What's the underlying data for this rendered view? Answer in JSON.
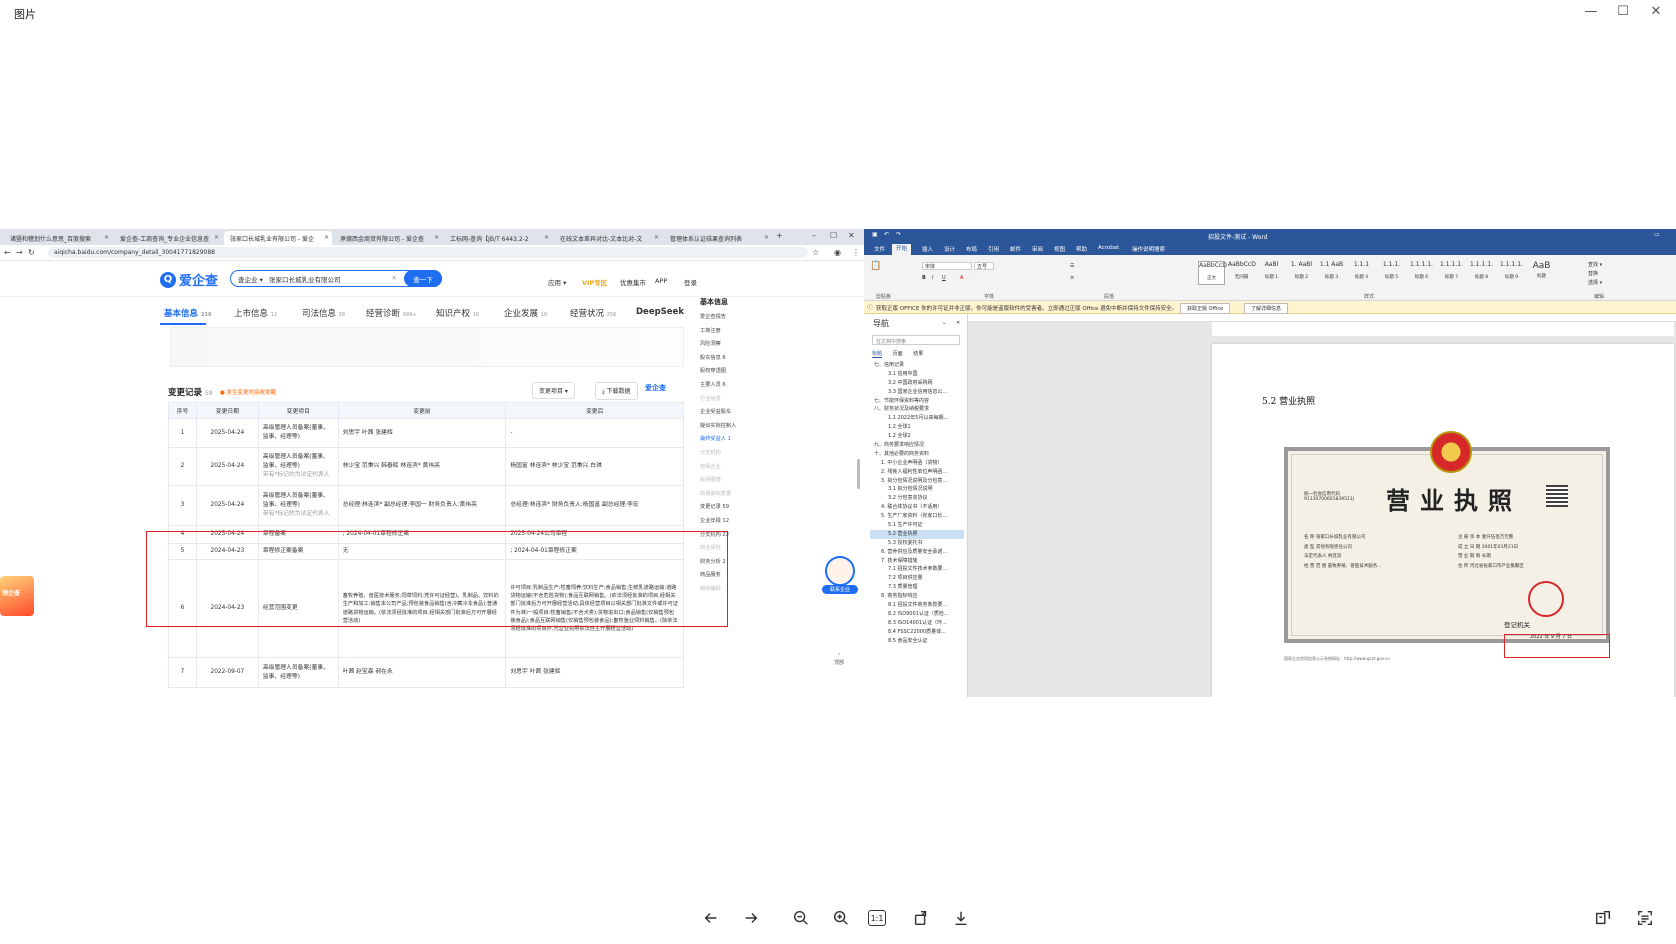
{
  "viewer": {
    "title": "图片",
    "controls": {
      "minimize": "—",
      "maximize": "☐",
      "close": "✕"
    },
    "toolbar_icons": [
      "arrow-left-icon",
      "arrow-right-icon",
      "zoom-out-icon",
      "zoom-in-icon",
      "actual-size-icon",
      "rotate-icon",
      "download-icon",
      "translate-icon",
      "ocr-icon"
    ],
    "actual_size_label": "1:1"
  },
  "browser": {
    "tabs": [
      "诸暨和稽划什么意思_百度搜索",
      "爱企查-工商查询_专业企业信息查",
      "张家口长城乳业有限公司 - 爱企",
      "承德西金周贸有限公司 - 爱企查",
      "工标网-查询【JB/T 6443.2-2",
      "在线文本差异对比-文本比对-文",
      "管理体系认证结果查询列表"
    ],
    "url": "aiqicha.baidu.com/company_detail_30041771829088",
    "site": {
      "logo": "爱企查",
      "search_scope": "查企业 ▾",
      "search_value": "张家口长城乳业有限公司",
      "search_button": "查一下",
      "links": [
        "应用 ▾",
        "VIP专区",
        "优惠集市",
        "APP",
        "登录"
      ]
    },
    "company_tabs": [
      {
        "label": "基本信息",
        "count": "216"
      },
      {
        "label": "上市信息",
        "count": "12"
      },
      {
        "label": "司法信息",
        "count": "58"
      },
      {
        "label": "经营诊断",
        "count": "999+"
      },
      {
        "label": "知识产权",
        "count": "16"
      },
      {
        "label": "企业发展",
        "count": "10"
      },
      {
        "label": "经营状况",
        "count": "256"
      },
      {
        "label": "DeepSeek",
        "count": ""
      }
    ],
    "change_record": {
      "title": "变更记录",
      "count": "59",
      "note": "● 发生变更时接收提醒",
      "filter_label": "变更项目 ▾",
      "download_label": "⤓ 下载数据",
      "badge": "爱企查",
      "headers": [
        "序号",
        "变更日期",
        "变更项目",
        "变更前",
        "变更后"
      ],
      "rows": [
        {
          "no": "1",
          "date": "2025-04-24",
          "item": "高级管理人员备案(董事、监事、经理等)",
          "before": "刘思宇 叶茜 张建辉",
          "after": "-"
        },
        {
          "no": "2",
          "date": "2025-04-24",
          "item": "高级管理人员备案(董事、监事、经理等)",
          "item_note": "带有*标记的为法定代表人",
          "before": "林少宝 范秉兴 韩春辉 林连滨* 黄伟亮",
          "after": "杨国富 林连滨* 林少宝 范秉兴 白琪"
        },
        {
          "no": "3",
          "date": "2025-04-24",
          "item": "高级管理人员备案(董事、监事、经理等)",
          "item_note": "带有*标记的为法定代表人",
          "before": "总经理:林连滨* 副总经理:李国一 财务负责人:黄伟亮",
          "after": "总经理:林连滨* 财务负责人:杨国富 副总经理:李宏"
        },
        {
          "no": "4",
          "date": "2025-04-24",
          "item": "章程备案",
          "before": "; 2024-04-01章程修正案",
          "after": "2025-04-24公司章程"
        },
        {
          "no": "5",
          "date": "2024-04-23",
          "item": "章程修正案备案",
          "before": "无",
          "after": "; 2024-04-01章程修正案"
        },
        {
          "no": "6",
          "date": "2024-04-23",
          "item": "经营范围变更",
          "before": "畜牧养殖、兽医技术服务;饲草饲料;凭许可证经营)。乳制品、饮料的生产和加工;销售本公司产品;预包装食品销售(含冷藏冷冻食品);普通道路货物运输。(依法须经批准的项目,经相关部门批准后方可开展经营活动)",
          "after": "许可项目:乳制品生产;牲畜饲养;饮料生产;食品销售;生鲜乳道路运输;道路货物运输(不含危险货物);食品互联网销售。(依法须经批准的项目,经相关部门批准后方可开展经营活动,具体经营项目以相关部门批准文件或许可证件为准)一般项目:牲畜销售(不含犬类);货物进出口;食品销售(仅销售预包装食品);食品互联网销售(仅销售预包装食品);畜牧渔业饲料销售。(除依法须经批准的项目外,凭营业执照依法自主开展经营活动)"
        },
        {
          "no": "7",
          "date": "2022-09-07",
          "item": "高级管理人员备案(董事、监事、经理等)",
          "before": "叶茜 赵宝森 郝在永",
          "after": "刘思宇 叶茜 张建辉"
        }
      ]
    },
    "side_nav": {
      "title": "基本信息",
      "items": [
        "爱企查报告",
        "工商注册",
        "风险洞察",
        "股东信息 6",
        "股权穿透图",
        "主要人员 6",
        "行业信息",
        "企业受益股东",
        "疑似实际控制人",
        "最终受益人 1",
        "分支机构",
        "控股企业",
        "投资图谱",
        "简易股权变更",
        "变更记录 59",
        "企业年报 12",
        "分支机构 22",
        "商业保险",
        "财务分析 2",
        "商品服务",
        "邮政编码"
      ]
    },
    "contact_label": "联系企业",
    "promo_text": "领企查",
    "back_top": "顶部"
  },
  "word": {
    "title": "招投文件-测试 - Word",
    "menu": [
      "文件",
      "开始",
      "插入",
      "设计",
      "布局",
      "引用",
      "邮件",
      "审阅",
      "视图",
      "帮助",
      "Acrobat",
      "操作说明搜索"
    ],
    "ribbon_groups": [
      "剪贴板",
      "字体",
      "段落",
      "样式",
      "编辑"
    ],
    "font_name": "宋体",
    "font_size": "五号",
    "styles": [
      {
        "preview": "AaBbCcD",
        "label": "正文"
      },
      {
        "preview": "AaBbCcD",
        "label": "无间隔"
      },
      {
        "preview": "AaBl",
        "label": "标题 1"
      },
      {
        "preview": "1. AaBl",
        "label": "标题 2"
      },
      {
        "preview": "1.1 AaB",
        "label": "标题 3"
      },
      {
        "preview": "1.1.1",
        "label": "标题 4"
      },
      {
        "preview": "1.1.1.",
        "label": "标题 5"
      },
      {
        "preview": "1.1.1.1.",
        "label": "标题 6"
      },
      {
        "preview": "1.1.1.1.",
        "label": "标题 7"
      },
      {
        "preview": "1.1.1.1.",
        "label": "标题 8"
      },
      {
        "preview": "1.1.1.1.",
        "label": "标题 9"
      },
      {
        "preview": "AaB",
        "label": "标题"
      }
    ],
    "edit_items": [
      "查找 ▾",
      "替换",
      "选择 ▾"
    ],
    "info_bar": "获取正版 OFFICE  你的许可证并非正版，你可能是盗版软件的受害者。立即通过正版 Office 避免中断并保持文件保持安全。",
    "info_buttons": [
      "获取正版 Office",
      "了解详细信息"
    ],
    "nav_pane": {
      "title": "导航",
      "search_placeholder": "在文档中搜索",
      "tabs": [
        "标题",
        "页面",
        "结果"
      ],
      "tree": [
        "七、信用记录",
        "3.1 信用中国",
        "3.2 中国政府采购网",
        "3.3 国家企业信用信息公...",
        "七、节能环保资料等内容",
        "八、财务状况及纳税要求",
        "1.1 2022年5月以来每期...",
        "1.2 全球1",
        "1.2 全球2",
        "九、商务要求响应情况",
        "十、其他必要的商务资料",
        "1. 中小企业声明函（货物）",
        "2. 残疾人福利性单位声明函...",
        "3. 拟分包情况说明及分包意...",
        "3.1 拟分包情况说明",
        "3.2 分包意向协议",
        "4. 联合体协议书（不适用）",
        "5. 生产厂家资料（张家口长...",
        "5.1 生产许可证",
        "5.2 营业执照",
        "5.3 授权委托书",
        "6. 营养供应及质量安全承诺...",
        "7. 技术保障措施",
        "7.1 招投文件技术参数要...",
        "7.2 项目供应量",
        "7.3 质量管理",
        "8. 商务指标响应",
        "8.1 招投文件商务条款要...",
        "8.2 ISO9001认证（质检...",
        "8.3 ISO14001认证（环...",
        "8.4 FSSC22000质量体...",
        "8.5 食品安全认证"
      ],
      "selected": "5.2 营业执照"
    },
    "heading": "5.2  营业执照",
    "license": {
      "title": "营业执照",
      "credit_code_label": "统一社会信用代码",
      "credit_code": "91130700601839511J",
      "fields_left": [
        "名 称   张家口长城乳业有限公司",
        "类 型   其他有限责任公司",
        "法定代表人  林连滨",
        "经 营 范 围  畜牧养殖、兽医技术服务..."
      ],
      "fields_right": [
        "注 册 资 本  壹仟伍佰万元整",
        "成 立 日 期  2001年03月21日",
        "营 业 期 限  长期",
        "住 所  河北省张家口市产业集聚区"
      ],
      "authority": "登记机关",
      "date": "2022 年 9 月 7 日"
    },
    "page_footer": "国家企业信用信息公示系统网址：http://www.gsxt.gov.cn"
  }
}
